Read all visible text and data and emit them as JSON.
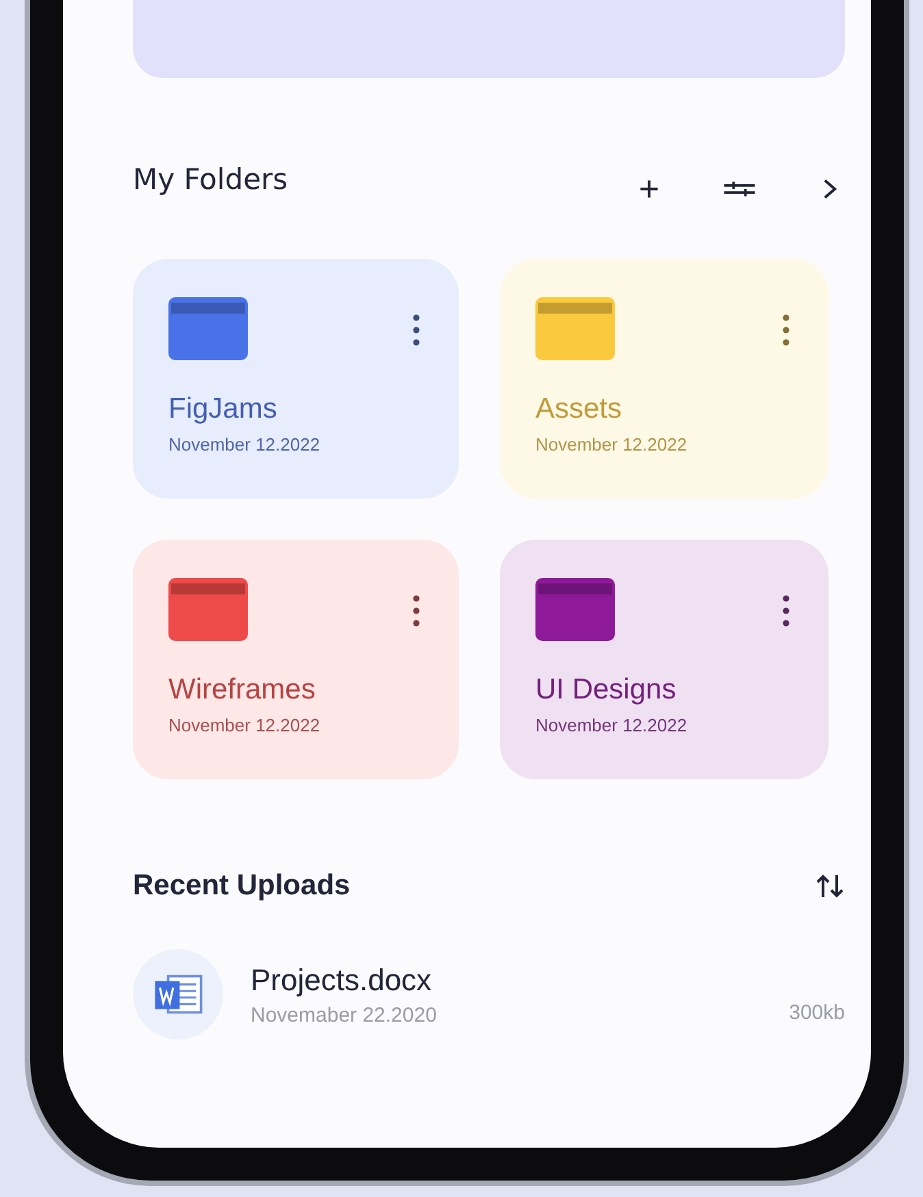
{
  "folders_section": {
    "title": "My Folders"
  },
  "folders": [
    {
      "name": "FigJams",
      "date": "November 12.2022",
      "color": "#4a72e8"
    },
    {
      "name": "Assets",
      "date": "November 12.2022",
      "color": "#fbc93e"
    },
    {
      "name": "Wireframes",
      "date": "November 12.2022",
      "color": "#ee4a4a"
    },
    {
      "name": "UI Designs",
      "date": "November 12.2022",
      "color": "#8e1a9a"
    }
  ],
  "recent_uploads": {
    "title": "Recent Uploads",
    "files": [
      {
        "name": "Projects.docx",
        "date": "Novemaber 22.2020",
        "size": "300kb"
      }
    ]
  }
}
